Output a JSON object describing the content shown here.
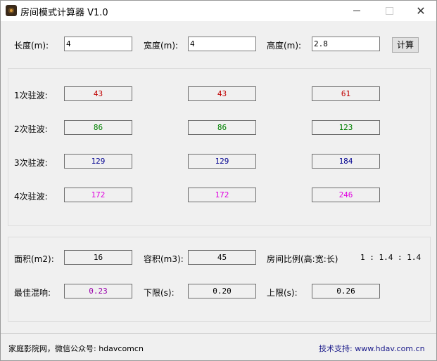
{
  "window": {
    "title": "房间模式计算器  V1.0",
    "min_glyph": "—",
    "max_glyph": "☐",
    "close_glyph": "✕"
  },
  "dimensions": {
    "length_label": "长度(m):",
    "length_value": "4",
    "width_label": "宽度(m):",
    "width_value": "4",
    "height_label": "高度(m):",
    "height_value": "2.8",
    "calc_button": "计算"
  },
  "modes": {
    "rows": [
      {
        "label": "1次驻波:",
        "values": [
          "43",
          "43",
          "61"
        ],
        "color": "#c00000"
      },
      {
        "label": "2次驻波:",
        "values": [
          "86",
          "86",
          "123"
        ],
        "color": "#008000"
      },
      {
        "label": "3次驻波:",
        "values": [
          "129",
          "129",
          "184"
        ],
        "color": "#000090"
      },
      {
        "label": "4次驻波:",
        "values": [
          "172",
          "172",
          "246"
        ],
        "color": "#e000e0"
      }
    ]
  },
  "results": {
    "area_label": "面积(m2):",
    "area_value": "16",
    "volume_label": "容积(m3):",
    "volume_value": "45",
    "ratio_label": "房间比例(高:宽:长)",
    "ratio_value": "1 : 1.4 : 1.4",
    "reverb_label": "最佳混响:",
    "reverb_value": "0.23",
    "reverb_color": "#9900aa",
    "lower_label": "下限(s):",
    "lower_value": "0.20",
    "upper_label": "上限(s):",
    "upper_value": "0.26"
  },
  "footer": {
    "left_text": "家庭影院网，微信公众号: hdavcomcn",
    "right_text": "技术支持: www.hdav.com.cn"
  }
}
